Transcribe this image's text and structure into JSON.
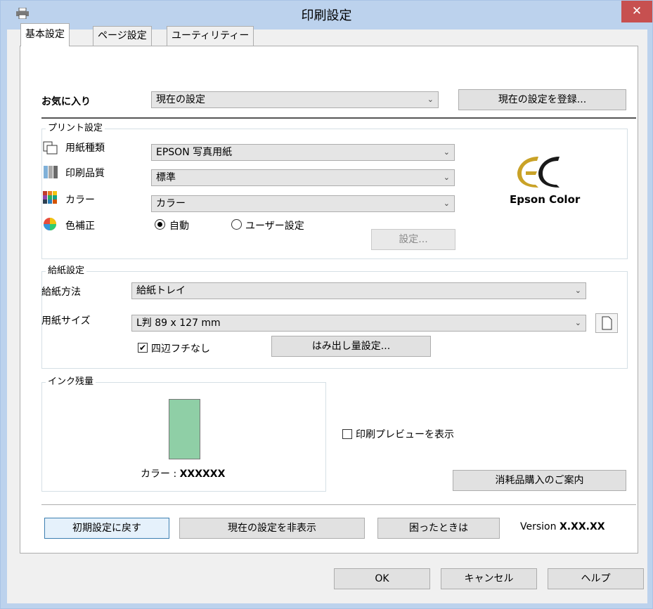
{
  "window": {
    "title": "印刷設定",
    "close_glyph": "✕"
  },
  "tabs": [
    {
      "label": "基本設定",
      "active": true
    },
    {
      "label": "ページ設定",
      "active": false
    },
    {
      "label": "ユーティリティー",
      "active": false
    }
  ],
  "favorites": {
    "label": "お気に入り",
    "selected": "現在の設定",
    "register_button": "現在の設定を登録..."
  },
  "print_settings": {
    "group_label": "プリント設定",
    "paper_type": {
      "label": "用紙種類",
      "value": "EPSON 写真用紙",
      "icon": "paper-type-icon"
    },
    "quality": {
      "label": "印刷品質",
      "value": "標準",
      "icon": "print-quality-icon"
    },
    "color": {
      "label": "カラー",
      "value": "カラー",
      "icon": "color-grid-icon"
    },
    "color_correction": {
      "label": "色補正",
      "icon": "color-wheel-icon",
      "auto_label": "自動",
      "user_label": "ユーザー設定",
      "selected": "auto",
      "settings_button": "設定..."
    },
    "logo_text": "Epson Color",
    "logo_mark": "EC"
  },
  "paper_settings": {
    "group_label": "給紙設定",
    "source": {
      "label": "給紙方法",
      "value": "給紙トレイ"
    },
    "size": {
      "label": "用紙サイズ",
      "value": "L判 89 x 127 mm"
    },
    "borderless": {
      "label": "四辺フチなし",
      "checked": true
    },
    "expansion_button": "はみ出し量設定..."
  },
  "ink_levels": {
    "group_label": "インク残量",
    "cartridge_label": "カラー : ",
    "cartridge_value": "XXXXXX",
    "level": 1.0,
    "cartridge_color": "#8fcfa6"
  },
  "preview": {
    "label": "印刷プレビューを表示",
    "checked": false
  },
  "supplies_button": "消耗品購入のご案内",
  "bottom_buttons": {
    "reset": "初期設定に戻す",
    "hide": "現在の設定を非表示",
    "help_trouble": "困ったときは",
    "version_prefix": "Version ",
    "version": "X.XX.XX"
  },
  "dialog_buttons": {
    "ok": "OK",
    "cancel": "キャンセル",
    "help": "ヘルプ"
  }
}
